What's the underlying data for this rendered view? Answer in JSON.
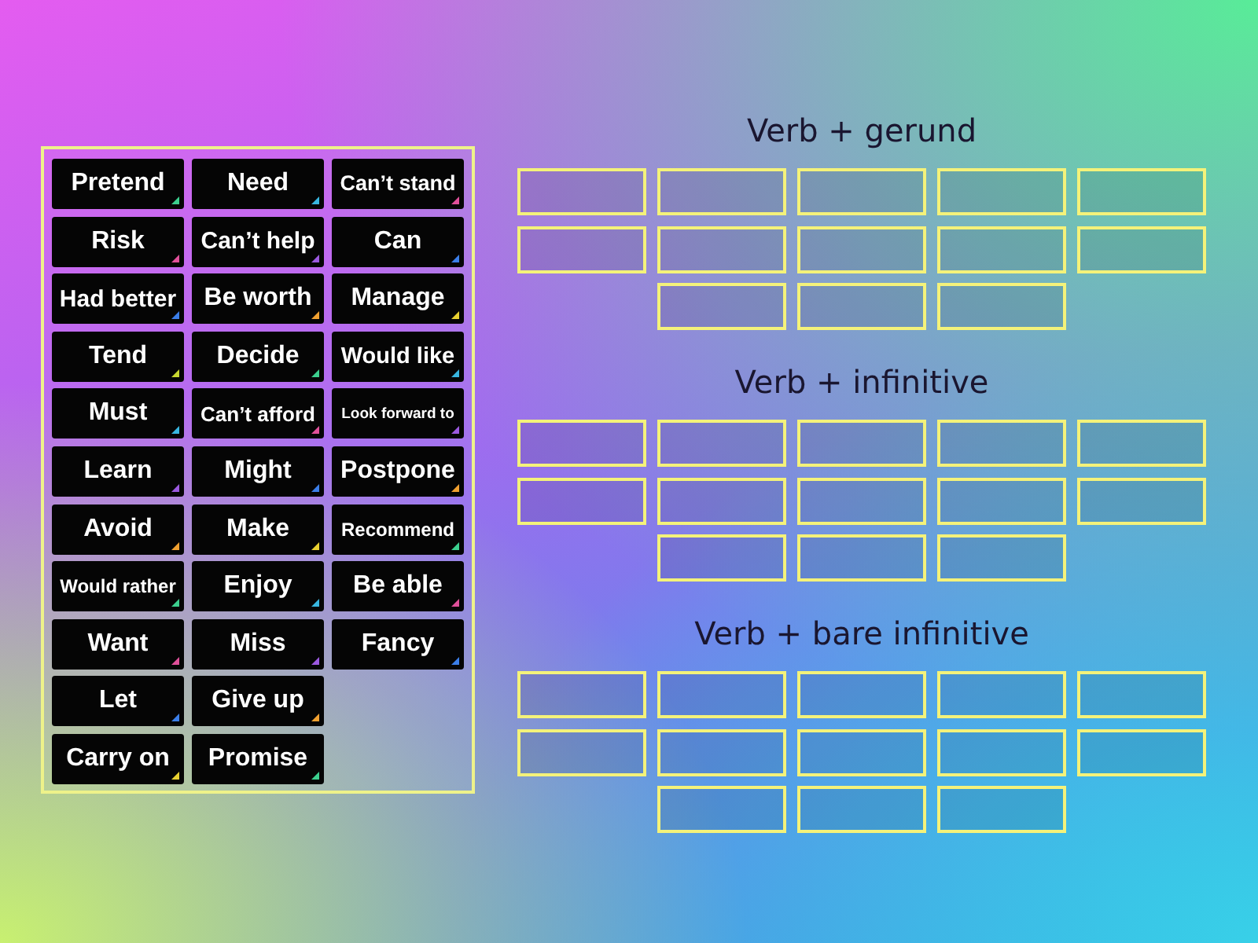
{
  "word_bank": {
    "cards": [
      {
        "text": "Pretend",
        "color": "#3ccf8e"
      },
      {
        "text": "Risk",
        "color": "#e0509a"
      },
      {
        "text": "Had better",
        "color": "#3b7ee8"
      },
      {
        "text": "Tend",
        "color": "#c8d830"
      },
      {
        "text": "Must",
        "color": "#38b6e0"
      },
      {
        "text": "Learn",
        "color": "#9b59e0"
      },
      {
        "text": "Avoid",
        "color": "#f0a030"
      },
      {
        "text": "Would rather",
        "color": "#3ccf8e"
      },
      {
        "text": "Want",
        "color": "#e0509a"
      },
      {
        "text": "Let",
        "color": "#3b7ee8"
      },
      {
        "text": "Carry on",
        "color": "#e8d030"
      },
      {
        "text": "Need",
        "color": "#38b6e0"
      },
      {
        "text": "Can’t help",
        "color": "#9b59e0"
      },
      {
        "text": "Be worth",
        "color": "#f0a030"
      },
      {
        "text": "Decide",
        "color": "#3ccf8e"
      },
      {
        "text": "Can’t afford",
        "color": "#e0509a"
      },
      {
        "text": "Might",
        "color": "#3b7ee8"
      },
      {
        "text": "Make",
        "color": "#e8d030"
      },
      {
        "text": "Enjoy",
        "color": "#38b6e0"
      },
      {
        "text": "Miss",
        "color": "#9b59e0"
      },
      {
        "text": "Give up",
        "color": "#f0a030"
      },
      {
        "text": "Promise",
        "color": "#3ccf8e"
      },
      {
        "text": "Can’t stand",
        "color": "#e0509a"
      },
      {
        "text": "Can",
        "color": "#3b7ee8"
      },
      {
        "text": "Manage",
        "color": "#e8d030"
      },
      {
        "text": "Would like",
        "color": "#38b6e0"
      },
      {
        "text": "Look forward to",
        "color": "#9b59e0"
      },
      {
        "text": "Postpone",
        "color": "#f0a030"
      },
      {
        "text": "Recommend",
        "color": "#3ccf8e"
      },
      {
        "text": "Be able",
        "color": "#e0509a"
      },
      {
        "text": "Fancy",
        "color": "#3b7ee8"
      }
    ]
  },
  "groups": [
    {
      "title": "Verb + gerund"
    },
    {
      "title": "Verb + infinitive"
    },
    {
      "title": "Verb + bare infinitive"
    }
  ]
}
